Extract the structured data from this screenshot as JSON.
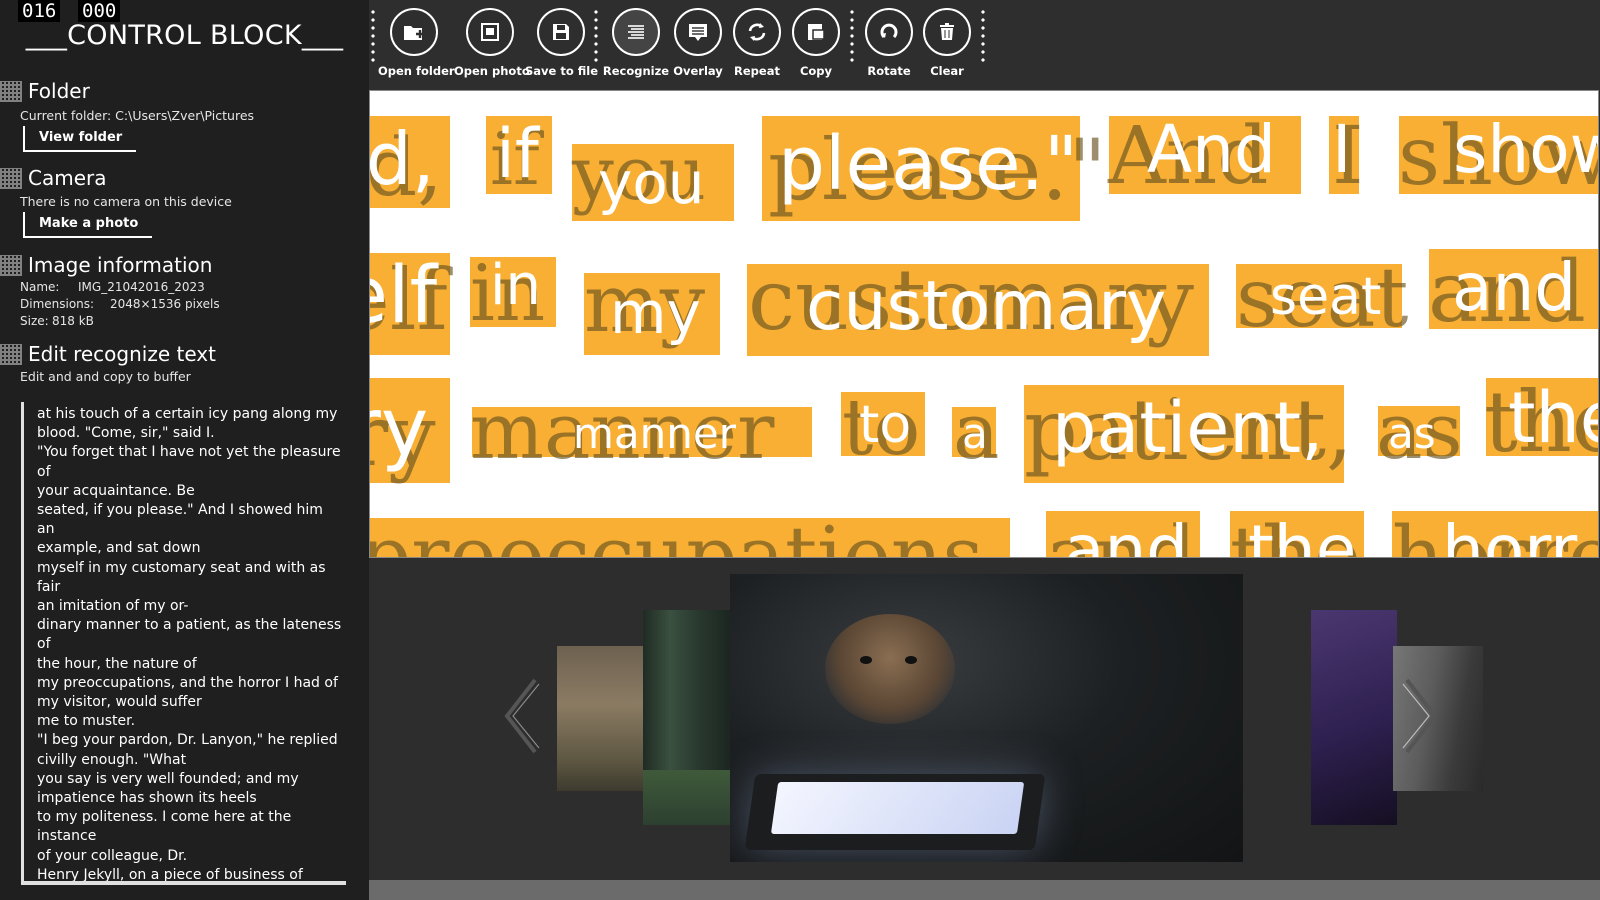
{
  "counters": {
    "left": "016",
    "right": "000"
  },
  "panel": {
    "title": "___CONTROL BLOCK___",
    "folder": {
      "heading": "Folder",
      "current": "Current folder: C:\\Users\\Zver\\Pictures",
      "button": "View folder"
    },
    "camera": {
      "heading": "Camera",
      "status": "There is no camera on this device",
      "button": "Make a photo"
    },
    "image_info": {
      "heading": "Image information",
      "name_label": "Name:",
      "name_value": "IMG_21042016_2023",
      "dim_label": "Dimensions:",
      "dim_value": "2048×1536 pixels",
      "size_label": "Size:",
      "size_value": "818 kB"
    },
    "edit": {
      "heading": "Edit recognize text",
      "sub": "Edit and and copy to buffer",
      "text": "at his touch of a certain icy pang along my\nblood. \"Come, sir,\" said I.\n\"You forget that I have not yet the pleasure of\nyour acquaintance. Be\nseated, if you please.\" And I showed him an\nexample, and sat down\nmyself in my customary seat and with as fair\nan imitation of my or-\ndinary manner to a patient, as the lateness of\nthe hour, the nature of\nmy preoccupations, and the horror I had of\nmy visitor, would suffer\nme to muster.\n\"I beg your pardon, Dr. Lanyon,\" he replied\ncivilly enough. \"What\nyou say is very well founded; and my\nimpatience has shown its heels\nto my politeness. I come here at the instance\nof your colleague, Dr.\nHenry Jekyll, on a piece of business of some\nmoment; and I under-\nstood. .\" He paused and put his hand to his\nthroat, and I could see,\nin spite of his collected manner, that he was"
    }
  },
  "toolbar": {
    "buttons": [
      {
        "label": "Open folder",
        "icon": "folder-add-icon"
      },
      {
        "label": "Open photo",
        "icon": "photo-icon"
      },
      {
        "label": "Save to file",
        "icon": "save-icon"
      },
      {
        "label": "Recognize",
        "icon": "lines-icon"
      },
      {
        "label": "Overlay",
        "icon": "overlay-icon"
      },
      {
        "label": "Repeat",
        "icon": "repeat-icon"
      },
      {
        "label": "Copy",
        "icon": "copy-icon"
      },
      {
        "label": "Rotate",
        "icon": "rotate-icon"
      },
      {
        "label": "Clear",
        "icon": "trash-icon"
      }
    ]
  },
  "viewer": {
    "words": [
      "d,",
      "if",
      "you",
      "please.\"",
      "And",
      "I",
      "show",
      "elf",
      "in",
      "my",
      "customary",
      "seat",
      "and",
      "ry",
      "manner",
      "to",
      "a",
      "patient,",
      "as",
      "the",
      "and",
      "the",
      "horr"
    ],
    "highlight_color": "#f7a823"
  },
  "gallery": {
    "thumbnails": [
      "forest-fog-photo",
      "dark-forest-photo",
      "cat-tablet-photo",
      "purple-photo",
      "car-interior-photo"
    ]
  }
}
